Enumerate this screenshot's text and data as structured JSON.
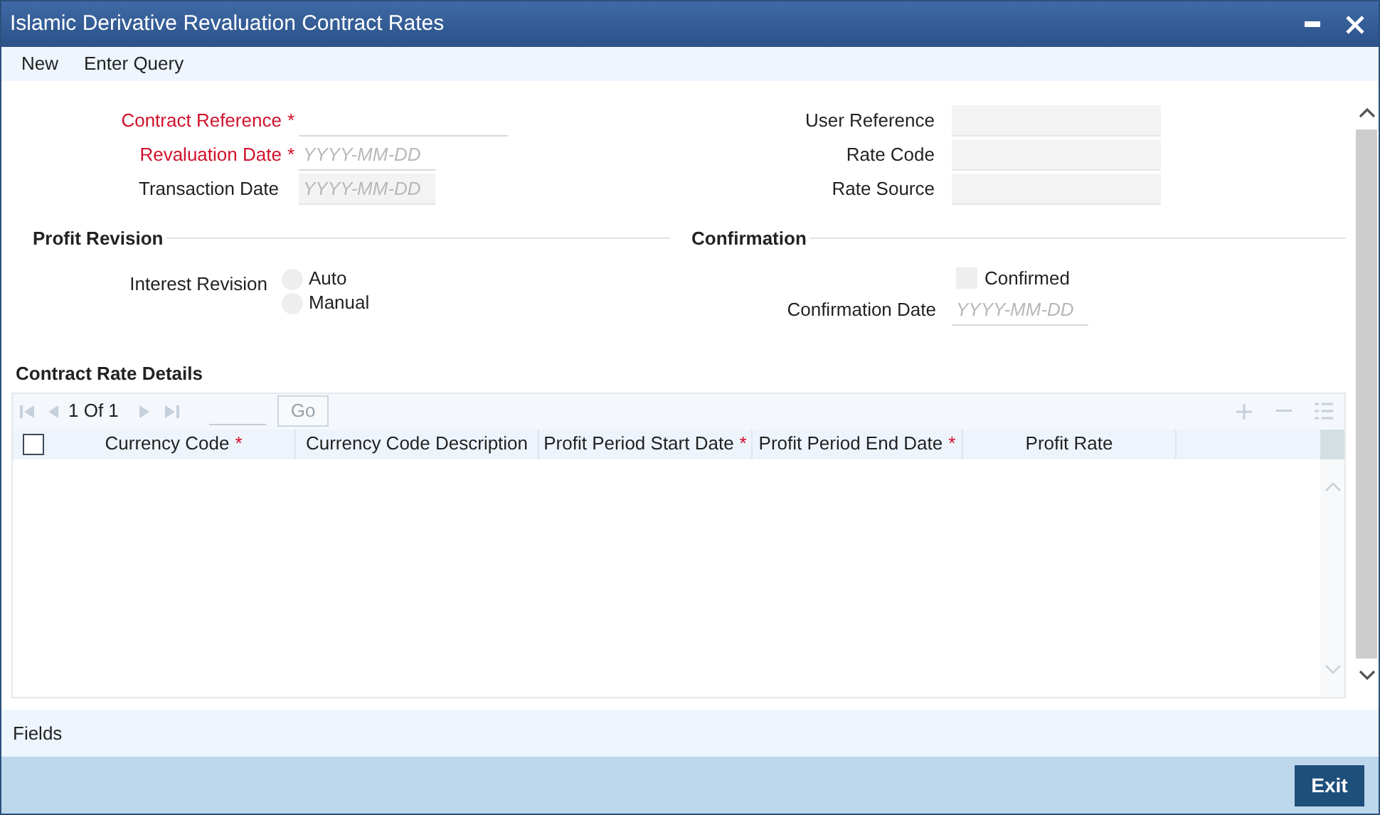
{
  "window": {
    "title": "Islamic Derivative Revaluation Contract Rates"
  },
  "menu": [
    "New",
    "Enter Query"
  ],
  "left_fields": [
    {
      "label": "Contract Reference",
      "required_mark": "*",
      "kind": "line"
    },
    {
      "label": "Revaluation Date",
      "required_mark": "*",
      "kind": "date",
      "placeholder": "YYYY-MM-DD"
    },
    {
      "label": "Transaction Date",
      "kind": "filled-date",
      "placeholder": "YYYY-MM-DD"
    }
  ],
  "right_fields": [
    {
      "label": "User Reference"
    },
    {
      "label": "Rate Code"
    },
    {
      "label": "Rate Source"
    }
  ],
  "profit_revision": {
    "title": "Profit Revision",
    "label": "Interest Revision",
    "options": [
      {
        "label": "Auto",
        "selected": false
      },
      {
        "label": "Manual",
        "selected": false
      }
    ]
  },
  "confirmation": {
    "title": "Confirmation",
    "checkbox": {
      "label": "Confirmed",
      "checked": false
    },
    "date_label": "Confirmation Date",
    "date_placeholder": "YYYY-MM-DD"
  },
  "table": {
    "title": "Contract Rate Details",
    "pager": "1 Of 1",
    "go": "Go",
    "select_all_checked": false,
    "columns": [
      {
        "label": "Currency Code",
        "required_mark": "*"
      },
      {
        "label": "Currency Code Description"
      },
      {
        "label": "Profit Period Start Date",
        "required_mark": "*"
      },
      {
        "label": "Profit Period End Date",
        "required_mark": "*"
      },
      {
        "label": "Profit Rate"
      }
    ]
  },
  "footer": {
    "fields": "Fields",
    "exit": "Exit"
  }
}
